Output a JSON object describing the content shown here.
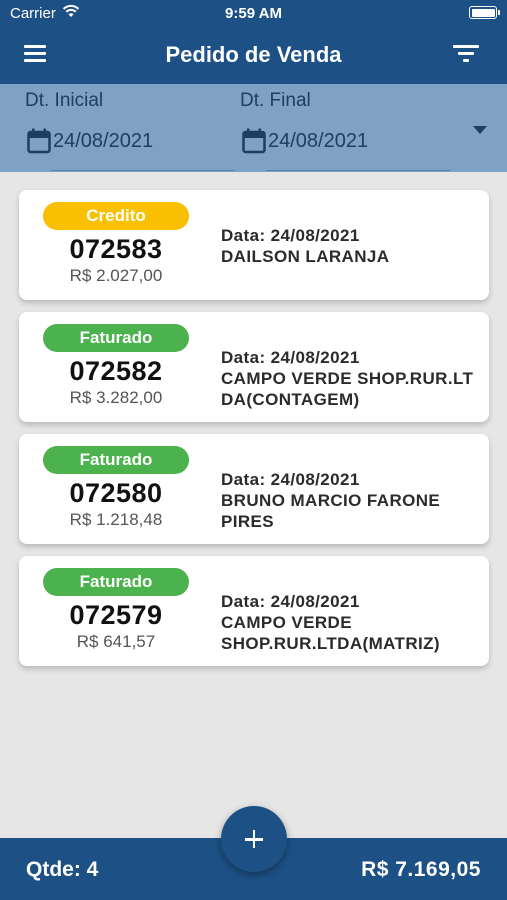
{
  "status_bar": {
    "carrier": "Carrier",
    "time": "9:59 AM"
  },
  "header": {
    "title": "Pedido de Venda",
    "menu_icon": "hamburger-menu-icon",
    "filter_icon": "filter-icon"
  },
  "date_filter": {
    "start": {
      "label": "Dt. Inicial",
      "value": "24/08/2021"
    },
    "end": {
      "label": "Dt. Final",
      "value": "24/08/2021"
    }
  },
  "orders": [
    {
      "status": "Credito",
      "status_color": "#f8c000",
      "number": "072583",
      "amount": "R$  2.027,00",
      "date": "Data: 24/08/2021",
      "customer": "DAILSON LARANJA"
    },
    {
      "status": "Faturado",
      "status_color": "#4bb24d",
      "number": "072582",
      "amount": "R$  3.282,00",
      "date": "Data: 24/08/2021",
      "customer": "CAMPO VERDE SHOP.RUR.LTDA(CONTAGEM)"
    },
    {
      "status": "Faturado",
      "status_color": "#4bb24d",
      "number": "072580",
      "amount": "R$  1.218,48",
      "date": "Data: 24/08/2021",
      "customer": "BRUNO MARCIO FARONE PIRES"
    },
    {
      "status": "Faturado",
      "status_color": "#4bb24d",
      "number": "072579",
      "amount": "R$  641,57",
      "date": "Data: 24/08/2021",
      "customer": "CAMPO VERDE SHOP.RUR.LTDA(MATRIZ)"
    }
  ],
  "footer": {
    "qtde": "Qtde: 4",
    "total": "R$  7.169,05",
    "add_icon": "plus-icon"
  },
  "colors": {
    "primary": "#1d5186",
    "filter_bar": "#7fa2c4",
    "credito": "#f8c000",
    "faturado": "#4bb24d"
  }
}
